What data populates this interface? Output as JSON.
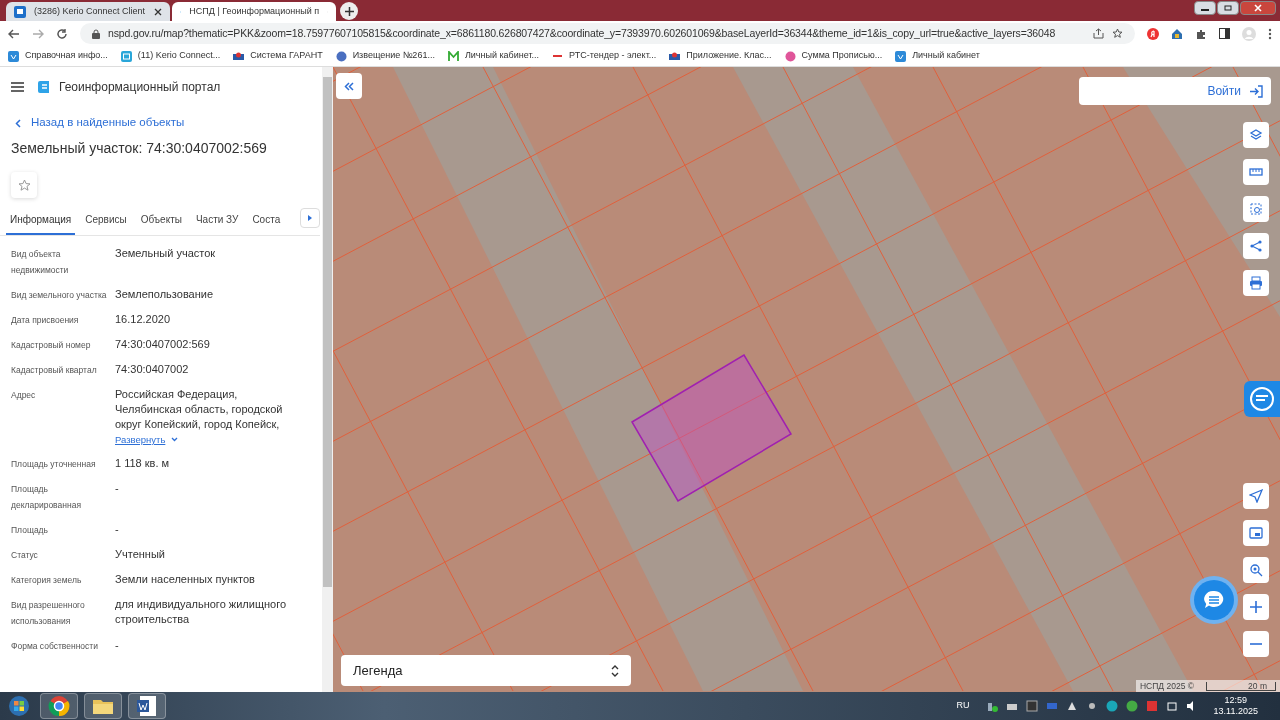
{
  "browser": {
    "tabs": [
      {
        "title": "(3286) Kerio Connect Client",
        "selected": false
      },
      {
        "title": "НСПД | Геоинформационный п",
        "selected": true
      }
    ],
    "url": "nspd.gov.ru/map?thematic=PKK&zoom=18.75977607105815&coordinate_x=6861180.626807427&coordinate_y=7393970.602601069&baseLayerId=36344&theme_id=1&is_copy_url=true&active_layers=36048",
    "bookmarks": [
      "Справочная инфо...",
      "(11) Kerio Connect...",
      "Система ГАРАНТ",
      "Извещение №261...",
      "Личный кабинет...",
      "РТС-тендер - элект...",
      "Приложение. Клас...",
      "Сумма Прописью...",
      "Личный кабинет"
    ]
  },
  "sidebar": {
    "app_title": "Геоинформационный портал",
    "back_link": "Назад в найденные объекты",
    "heading": "Земельный участок: 74:30:0407002:569",
    "tabs": [
      {
        "label": "Информация",
        "selected": true
      },
      {
        "label": "Сервисы",
        "selected": false
      },
      {
        "label": "Объекты",
        "selected": false
      },
      {
        "label": "Части ЗУ",
        "selected": false
      },
      {
        "label": "Соста",
        "selected": false
      }
    ],
    "fields": [
      {
        "label": "Вид объекта недвижимости",
        "value": "Земельный участок"
      },
      {
        "label": "Вид земельного участка",
        "value": "Землепользование"
      },
      {
        "label": "Дата присвоения",
        "value": "16.12.2020"
      },
      {
        "label": "Кадастровый номер",
        "value": "74:30:0407002:569"
      },
      {
        "label": "Кадастровый квартал",
        "value": "74:30:0407002"
      },
      {
        "label": "Адрес",
        "value": "Российская Федерация, Челябинская область, городской округ Копейский, город Копейск,",
        "expand_link": "Развернуть"
      },
      {
        "label": "Площадь уточненная",
        "value": "1 118 кв. м"
      },
      {
        "label": "Площадь декларированная",
        "value": "-"
      },
      {
        "label": "Площадь",
        "value": "-"
      },
      {
        "label": "Статус",
        "value": "Учтенный"
      },
      {
        "label": "Категория земель",
        "value": "Земли населенных пунктов"
      },
      {
        "label": "Вид разрешенного использования",
        "value": "для индивидуального жилищного строительства"
      },
      {
        "label": "Форма собственности",
        "value": "-"
      }
    ]
  },
  "map": {
    "login_button": "Войти",
    "legend": "Легенда",
    "attribution": "НСПД 2025 ©",
    "scale": "20 m"
  },
  "taskbar": {
    "language": "RU",
    "time": "12:59",
    "date": "13.11.2025"
  }
}
